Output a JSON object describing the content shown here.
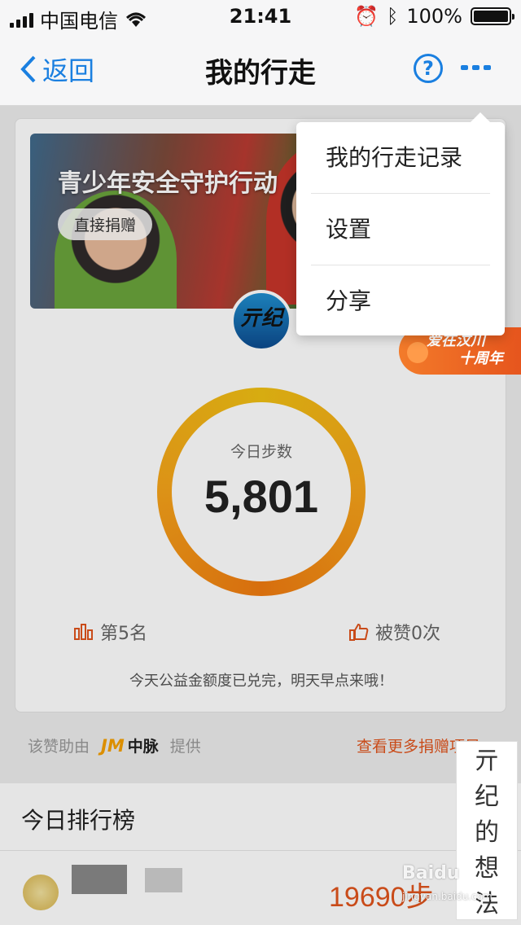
{
  "status_bar": {
    "carrier": "中国电信",
    "time": "21:41",
    "battery": "100%"
  },
  "nav": {
    "back_label": "返回",
    "title": "我的行走",
    "help_glyph": "?"
  },
  "banner": {
    "title": "青少年安全守护行动",
    "donate_label": "直接捐赠",
    "logo_text": "亓纪"
  },
  "steps": {
    "label": "今日步数",
    "value": "5,801",
    "progress": 1.0
  },
  "stats": {
    "rank": "第5名",
    "likes": "被赞0次"
  },
  "notice": "今天公益金额度已兑完，明天早点来哦！",
  "sponsor": {
    "prefix": "该赞助由",
    "brand": "中脉",
    "suffix": "提供"
  },
  "more_projects": "查看更多捐赠项目",
  "leaderboard": {
    "title": "今日排行榜",
    "first_steps": "19690步"
  },
  "promo": {
    "line1": "爱在汶川",
    "line2": "十周年"
  },
  "menu": {
    "items": [
      "我的行走记录",
      "设置",
      "分享"
    ]
  },
  "watermark": {
    "chars": [
      "亓",
      "纪",
      "的",
      "想",
      "法"
    ],
    "baidu": "Baidu",
    "baidu_sub": "jingyan.baidu.com"
  },
  "colors": {
    "accent": "#1a7fe0",
    "orange": "#e0541c",
    "ring_gold": "#f0c014"
  }
}
